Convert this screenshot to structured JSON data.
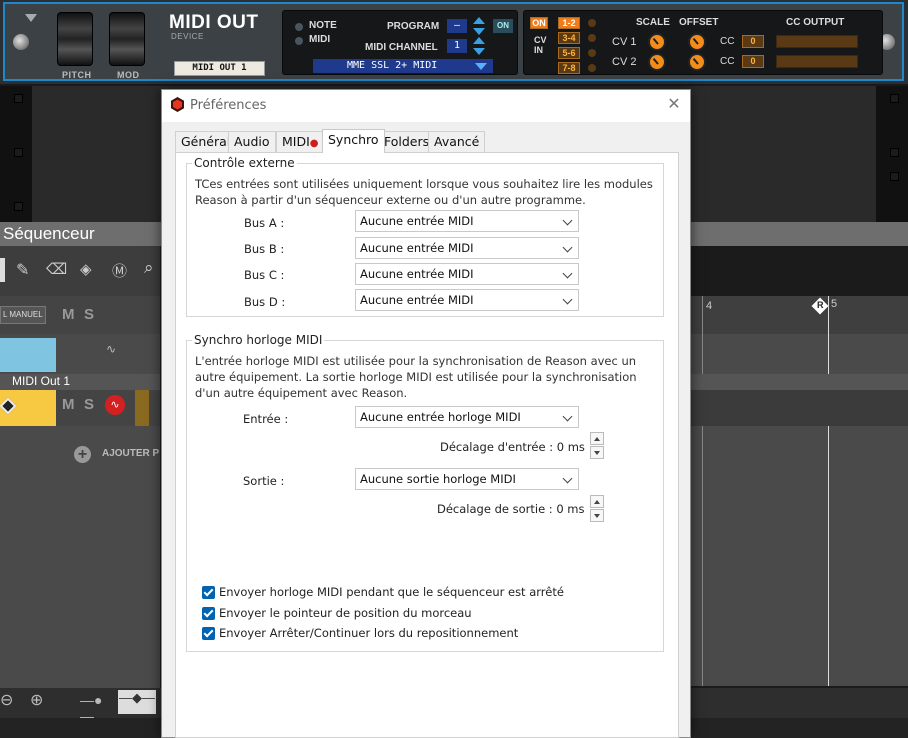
{
  "device": {
    "name": "MIDI OUT",
    "subtitle": "DEVICE",
    "tape_label": "MIDI OUT 1",
    "pitch_label": "PITCH",
    "mod_label": "MOD",
    "note_label": "NOTE",
    "midi_label": "MIDI",
    "program_label": "PROGRAM",
    "program_value": "—",
    "on_label": "ON",
    "channel_label": "MIDI CHANNEL",
    "channel_value": "1",
    "output_port": "MME SSL 2+ MIDI",
    "cv_on": "ON",
    "cv_in": "CV\nIN",
    "pairs": [
      "1-2",
      "3-4",
      "5-6",
      "7-8"
    ],
    "scale_label": "SCALE",
    "offset_label": "OFFSET",
    "cc_output_label": "CC OUTPUT",
    "cv1": "CV 1",
    "cv2": "CV 2",
    "cc": "CC",
    "cc1_value": "0",
    "cc2_value": "0"
  },
  "sequencer": {
    "title": "Séquenceur",
    "manual_label": "L MANUEL",
    "mute": "M",
    "solo": "S",
    "track_name": "MIDI Out 1",
    "add_track": "AJOUTER P",
    "marker_4": "4",
    "marker_5": "5",
    "marker_r": "R"
  },
  "dialog": {
    "title": "Préférences",
    "close": "✕",
    "tabs": [
      {
        "label": "Général"
      },
      {
        "label": "Audio"
      },
      {
        "label": "MIDI"
      },
      {
        "label": "Synchro"
      },
      {
        "label": "Folders"
      },
      {
        "label": "Avancé"
      }
    ],
    "midi_dot": "●",
    "external": {
      "title": "Contrôle externe",
      "desc": "TCes entrées sont utilisées uniquement lorsque vous souhaitez lire les modules Reason à partir d'un séquenceur externe ou d'un autre programme.",
      "buses": [
        {
          "label": "Bus A :",
          "value": "Aucune entrée MIDI"
        },
        {
          "label": "Bus B :",
          "value": "Aucune entrée MIDI"
        },
        {
          "label": "Bus C :",
          "value": "Aucune entrée MIDI"
        },
        {
          "label": "Bus D :",
          "value": "Aucune entrée MIDI"
        }
      ]
    },
    "clock": {
      "title": "Synchro horloge MIDI",
      "desc": "L'entrée horloge MIDI est utilisée pour la synchronisation de Reason avec un autre équipement. La sortie horloge MIDI est utilisée pour la synchronisation d'un autre équipement avec Reason.",
      "input_label": "Entrée :",
      "input_value": "Aucune entrée horloge MIDI",
      "input_offset": "Décalage d'entrée : 0 ms",
      "output_label": "Sortie :",
      "output_value": "Aucune sortie horloge MIDI",
      "output_offset": "Décalage de sortie : 0 ms"
    },
    "checkboxes": [
      {
        "label": "Envoyer horloge MIDI pendant que le séquenceur est arrêté",
        "checked": true
      },
      {
        "label": "Envoyer le pointeur de position du morceau",
        "checked": true
      },
      {
        "label": "Envoyer Arrêter/Continuer lors du repositionnement",
        "checked": true
      }
    ]
  }
}
